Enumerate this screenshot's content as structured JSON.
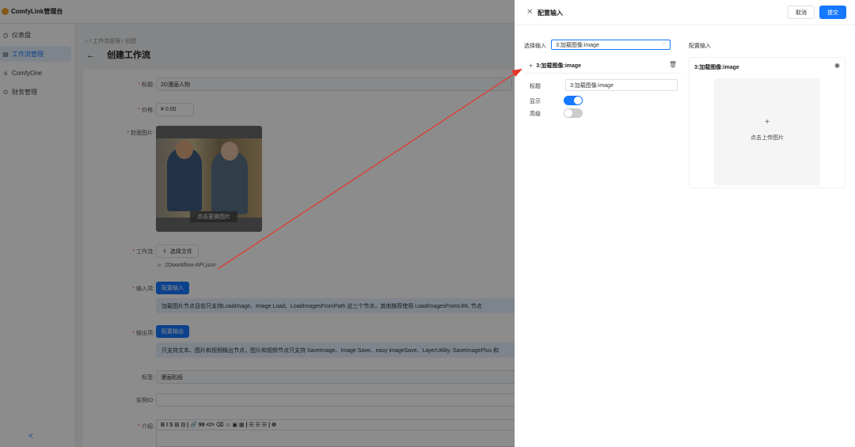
{
  "app": {
    "brand": "ComfyLink管理台"
  },
  "sidebar": {
    "items": [
      {
        "label": "仪表盘",
        "icon": "dashboard-icon",
        "glyph": "◷",
        "active": false
      },
      {
        "label": "工作流管理",
        "icon": "workflow-icon",
        "glyph": "▤",
        "active": true
      },
      {
        "label": "ComfyOne",
        "icon": "nodes-icon",
        "glyph": "ɞ",
        "active": false
      },
      {
        "label": "财务管理",
        "icon": "finance-icon",
        "glyph": "⊙",
        "active": false
      }
    ],
    "collapse_glyph": "<"
  },
  "breadcrumb": {
    "home_glyph": "⌂",
    "sep": "/",
    "parent": "工作流管理",
    "current": "创建"
  },
  "page": {
    "back_glyph": "←",
    "title": "创建工作流"
  },
  "form": {
    "title_label": "标题:",
    "title_value": "2D漫画人物",
    "price_label": "价格:",
    "price_value": "¥ 0.00",
    "cover_label": "封面图片:",
    "cover_caption": "点击更换图片",
    "workflow_label": "工作流:",
    "select_file": "选择文件",
    "upload_glyph": "⇪",
    "file_name": "2Dworkflow-API.json",
    "attach_glyph": "⌀",
    "input_label": "输入项:",
    "input_button": "配置输入",
    "input_note": "加载图片节点目前只支持LoadImage、Image Load、LoadImagesFromPath 这三个节点，其他推荐使用 LoadImagesFromURL 节点",
    "output_label": "输出项:",
    "output_button": "配置输出",
    "output_note": "只支持文本、图片和视频输出节点，图片和视频节点只支持 SaveImage、Image Save、easy imageSave、LayerUtility: SaveImagePlus 和",
    "tags_label": "标签:",
    "tags_value": "漫画贴纸",
    "instance_label": "实例ID:",
    "intro_label": "介绍:",
    "toolbar": "B I S ⊞ ⊟ | 🔗 99 </> ⌫ ☺ ▣ ▦ | ☰ ☰ ☰ | ❶"
  },
  "drawer": {
    "close_glyph": "✕",
    "title": "配置输入",
    "cancel": "取消",
    "submit": "提交",
    "select_label": "选择输入",
    "select_value": "3:加载图像:image",
    "chevron_glyph": "⌵",
    "card": {
      "plus_glyph": "+",
      "name": "3:加载图像:image",
      "trash_glyph": "🗑",
      "title_label": "标题",
      "title_value": "3:加载图像:image",
      "show_label": "显示",
      "show_on": true,
      "advanced_label": "高级",
      "advanced_on": false
    },
    "preview": {
      "label": "配置输入",
      "name": "3:加载图像:image",
      "eye_glyph": "◉",
      "upload_plus": "+",
      "upload_text": "点击上传图片"
    }
  }
}
